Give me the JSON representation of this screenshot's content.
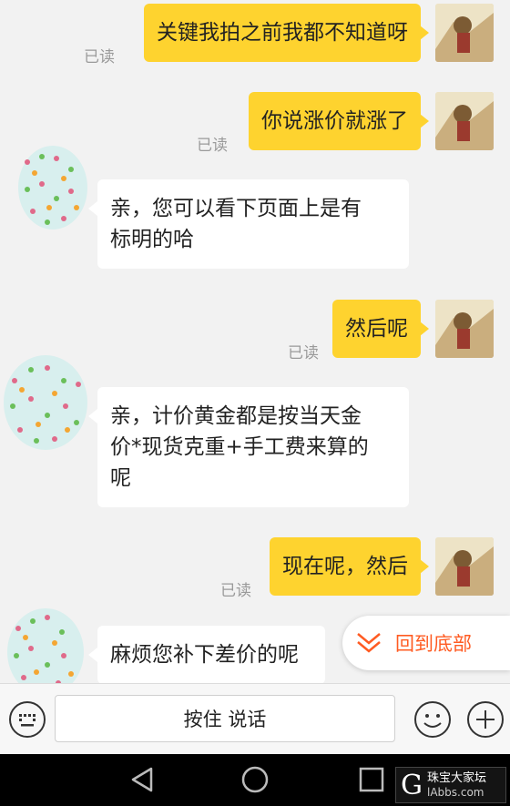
{
  "messages": [
    {
      "side": "out",
      "text": "关键我拍之前我都不知道呀",
      "read": "已读"
    },
    {
      "side": "out",
      "text": "你说涨价就涨了",
      "read": "已读"
    },
    {
      "side": "in",
      "lines": [
        "亲，您可以看下页面上是有",
        "标明的哈"
      ]
    },
    {
      "side": "out",
      "text": "然后呢",
      "read": "已读"
    },
    {
      "side": "in",
      "lines": [
        "亲，计价黄金都是按当天金",
        "价*现货克重+手工费来算的",
        "呢"
      ]
    },
    {
      "side": "out",
      "text": "现在呢，然后",
      "read": "已读"
    },
    {
      "side": "in",
      "lines": [
        "麻烦您补下差价的呢"
      ]
    }
  ],
  "scroll_to_bottom": {
    "label": "回到底部",
    "icon": "double-chevron-down-icon"
  },
  "input_bar": {
    "voice_label": "按住 说话",
    "left_icon": "keyboard-icon",
    "emoji_icon": "smiley-icon",
    "plus_icon": "plus-icon"
  },
  "nav": {
    "back": "back-icon",
    "home": "home-icon",
    "recents": "recents-icon"
  },
  "watermark": {
    "logo": "G",
    "line1": "珠宝大家坛",
    "line2": "lAbbs.com"
  },
  "colors": {
    "accent": "#fed32f",
    "link": "#ff5b22"
  }
}
